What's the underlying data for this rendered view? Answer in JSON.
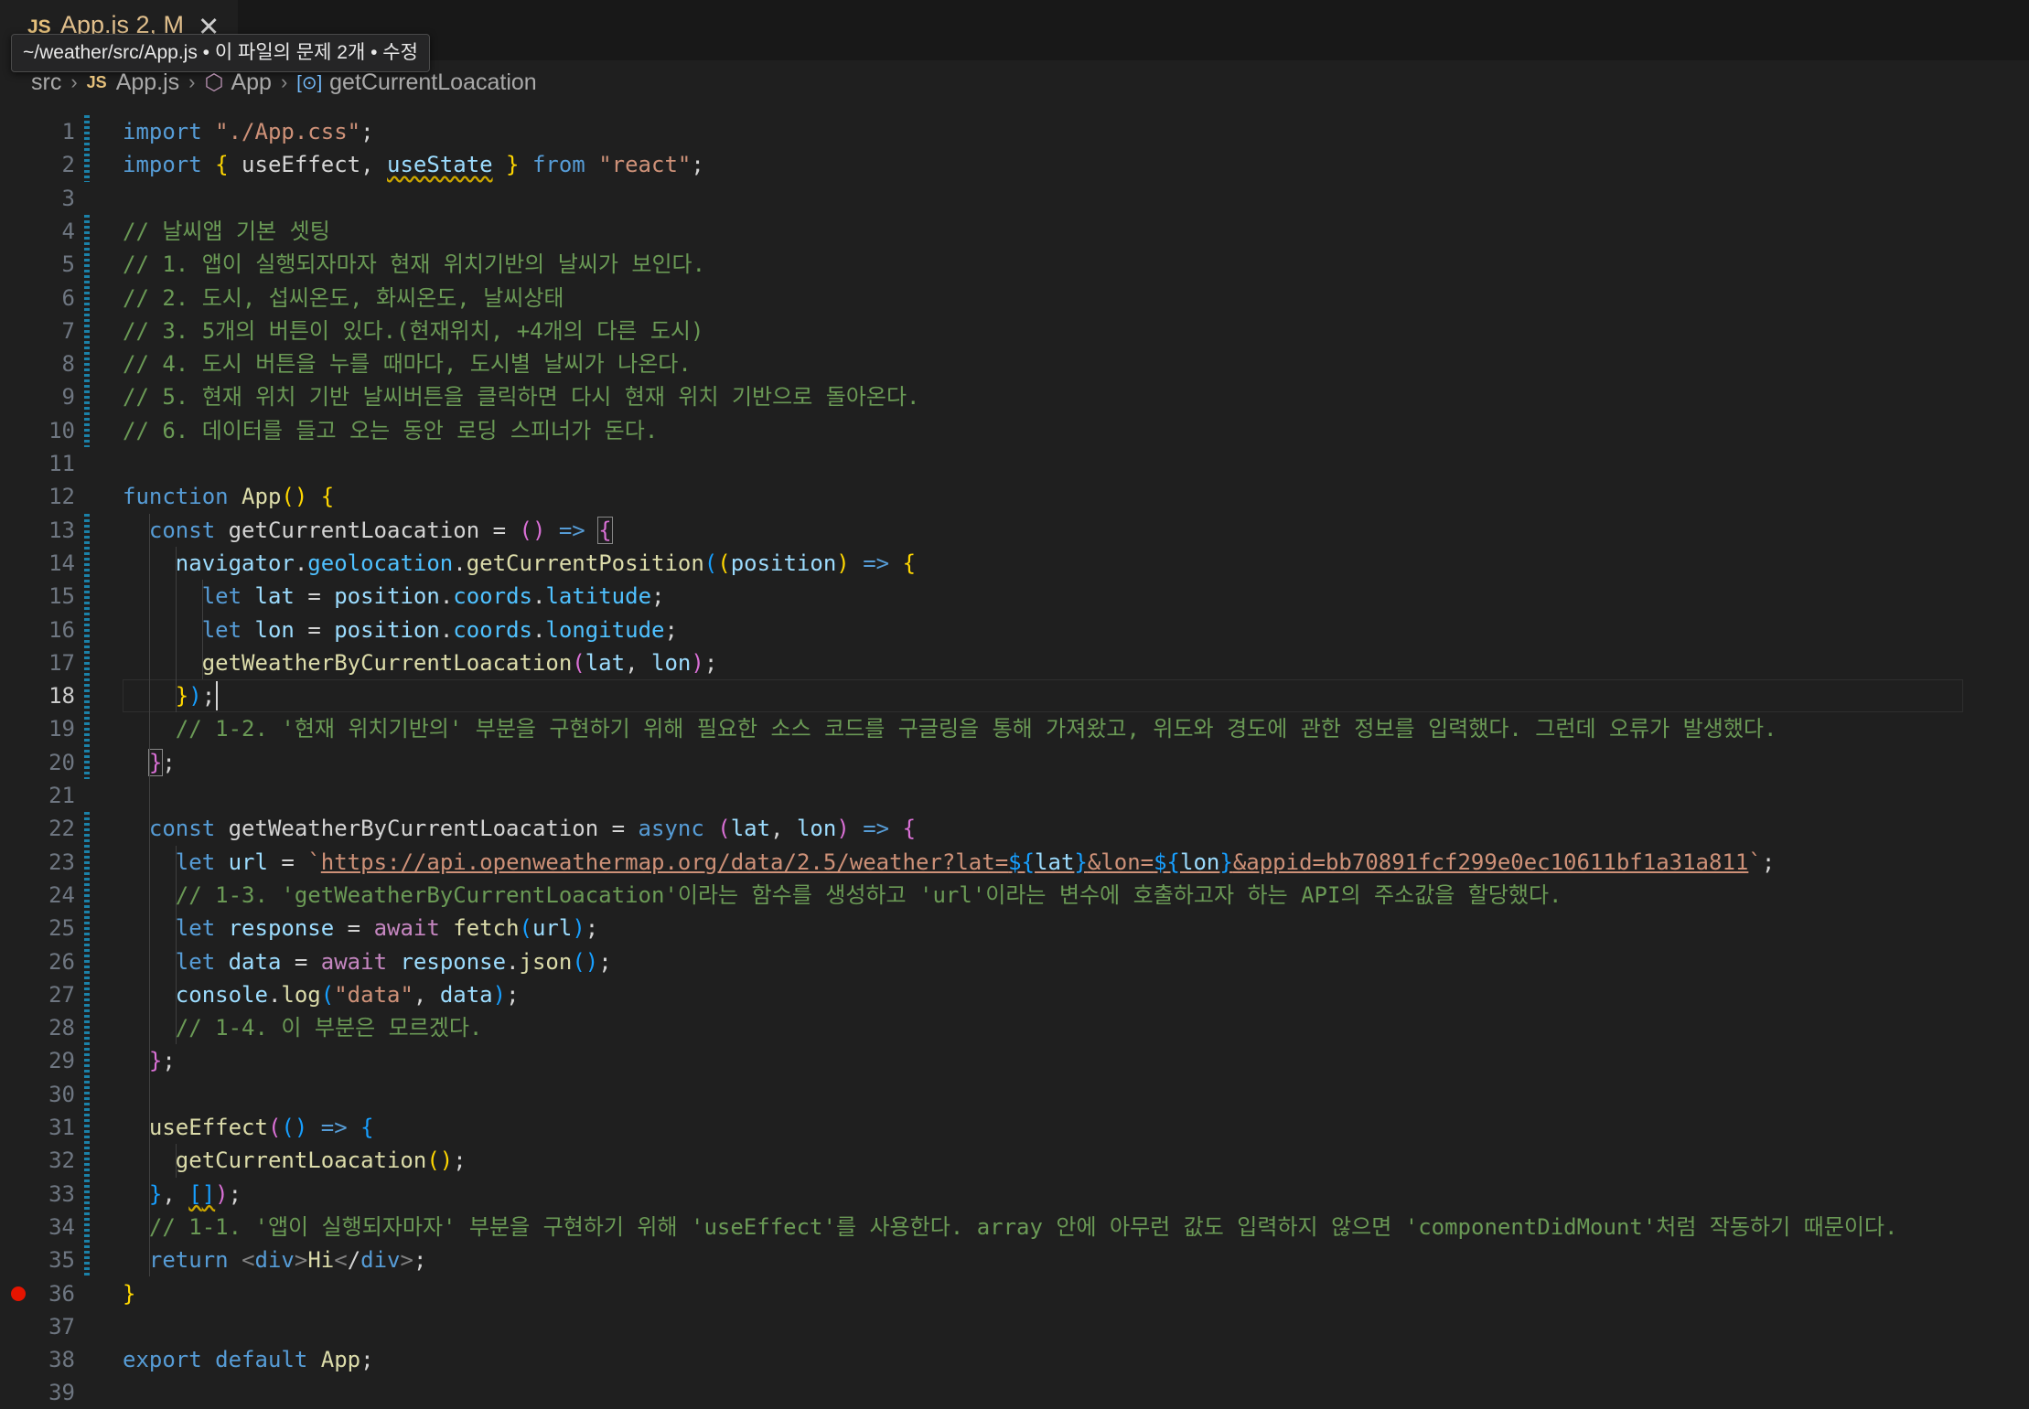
{
  "tab": {
    "lang": "JS",
    "name": "App.js 2, M",
    "close_icon": "close-icon"
  },
  "tooltip": "~/weather/src/App.js • 이 파일의 문제 2개 • 수정",
  "breadcrumb": [
    "src",
    "App.js",
    "App",
    "getCurrentLoacation"
  ],
  "editor": {
    "active_line": 18,
    "breakpoint_line": 36,
    "lines": [
      "import \"./App.css\";",
      "import { useEffect, useState } from \"react\";",
      "",
      "// 날씨앱 기본 셋팅",
      "// 1. 앱이 실행되자마자 현재 위치기반의 날씨가 보인다.",
      "// 2. 도시, 섭씨온도, 화씨온도, 날씨상태",
      "// 3. 5개의 버튼이 있다.(현재위치, +4개의 다른 도시)",
      "// 4. 도시 버튼을 누를 때마다, 도시별 날씨가 나온다.",
      "// 5. 현재 위치 기반 날씨버튼을 클릭하면 다시 현재 위치 기반으로 돌아온다.",
      "// 6. 데이터를 들고 오는 동안 로딩 스피너가 돈다.",
      "",
      "function App() {",
      "  const getCurrentLoacation = () => {",
      "    navigator.geolocation.getCurrentPosition((position) => {",
      "      let lat = position.coords.latitude;",
      "      let lon = position.coords.longitude;",
      "      getWeatherByCurrentLoacation(lat, lon);",
      "    });",
      "    // 1-2. '현재 위치기반의' 부분을 구현하기 위해 필요한 소스 코드를 구글링을 통해 가져왔고, 위도와 경도에 관한 정보를 입력했다. 그런데 오류가 발생했다.",
      "  };",
      "",
      "  const getWeatherByCurrentLoacation = async (lat, lon) => {",
      "    let url = `https://api.openweathermap.org/data/2.5/weather?lat=${lat}&lon=${lon}&appid=bb70891fcf299e0ec10611bf1a31a811`;",
      "    // 1-3. 'getWeatherByCurrentLoacation'이라는 함수를 생성하고 'url'이라는 변수에 호출하고자 하는 API의 주소값을 할당했다.",
      "    let response = await fetch(url);",
      "    let data = await response.json();",
      "    console.log(\"data\", data);",
      "    // 1-4. 이 부분은 모르겠다.",
      "  };",
      "",
      "  useEffect(() => {",
      "    getCurrentLoacation();",
      "  }, []);",
      "  // 1-1. '앱이 실행되자마자' 부분을 구현하기 위해 'useEffect'를 사용한다. array 안에 아무런 값도 입력하지 않으면 'componentDidMount'처럼 작동하기 때문이다.",
      "  return <div>Hi</div>;",
      "}",
      "",
      "export default App;",
      ""
    ]
  }
}
